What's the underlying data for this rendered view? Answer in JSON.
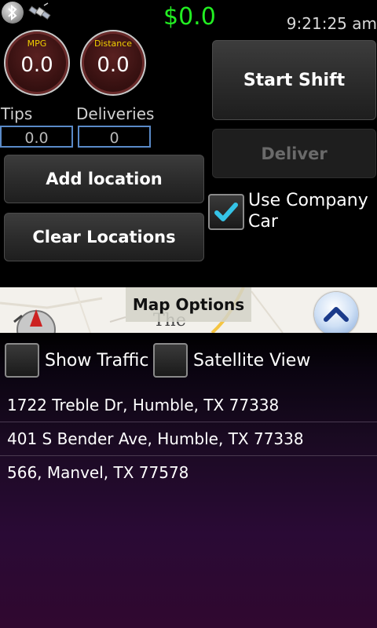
{
  "header": {
    "earnings": "$0.0",
    "clock": "9:21:25 am",
    "status_icons": [
      "bluetooth-icon",
      "satellite-icon"
    ]
  },
  "gauges": {
    "mpg": {
      "label": "MPG",
      "value": "0.0"
    },
    "distance": {
      "label": "Distance",
      "value": "0.0"
    }
  },
  "fields": {
    "tips": {
      "label": "Tips",
      "value": "0.0"
    },
    "deliveries": {
      "label": "Deliveries",
      "value": "0"
    }
  },
  "buttons": {
    "add_location": "Add location",
    "clear_locations": "Clear Locations",
    "start_shift": "Start Shift",
    "deliver": "Deliver"
  },
  "company_car": {
    "label": "Use Company Car",
    "checked": true
  },
  "map": {
    "options_label": "Map Options",
    "visible_text": "The"
  },
  "map_toggles": {
    "traffic": {
      "label": "Show Traffic",
      "checked": false
    },
    "satellite": {
      "label": "Satellite View",
      "checked": false
    }
  },
  "locations": [
    {
      "address": "1722 Treble Dr, Humble, TX 77338"
    },
    {
      "address": "401 S Bender Ave, Humble, TX 77338"
    },
    {
      "address": "566, Manvel, TX 77578"
    }
  ],
  "colors": {
    "earnings": "#22ee22",
    "gauge_label": "#f0d000",
    "field_border": "#5a8ac8",
    "checkmark": "#35c3e6"
  }
}
